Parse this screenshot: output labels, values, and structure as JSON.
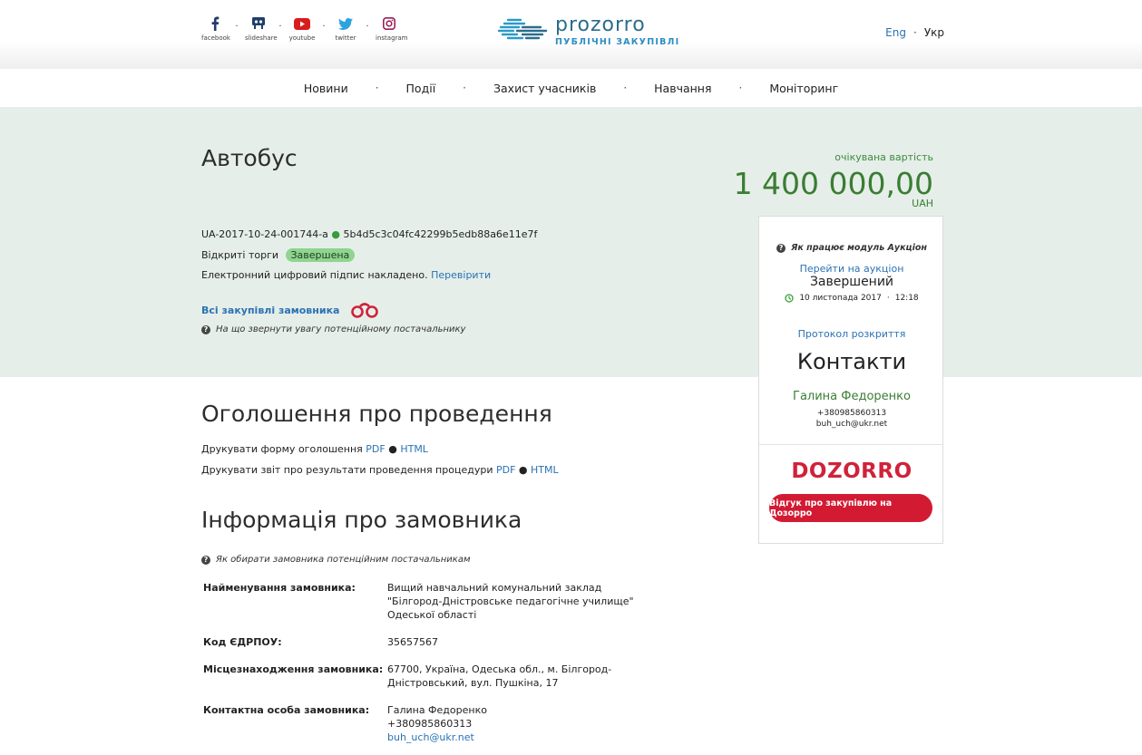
{
  "social": [
    {
      "label": "facebook",
      "icon": "facebook-icon"
    },
    {
      "label": "slideshare",
      "icon": "slideshare-icon"
    },
    {
      "label": "youtube",
      "icon": "youtube-icon"
    },
    {
      "label": "twitter",
      "icon": "twitter-icon"
    },
    {
      "label": "instagram",
      "icon": "instagram-icon"
    }
  ],
  "logo": {
    "name": "prozorro",
    "tagline": "ПУБЛІЧНІ ЗАКУПІВЛІ"
  },
  "lang": {
    "eng": "Eng",
    "ukr": "Укр"
  },
  "nav": [
    "Новини",
    "Події",
    "Захист учасників",
    "Навчання",
    "Моніторинг"
  ],
  "tender": {
    "title": "Автобус",
    "id": "UA-2017-10-24-001744-a",
    "hash": "5b4d5c3c04fc42299b5edb88a6e11e7f",
    "procedure": "Відкриті торги",
    "status": "Завершена",
    "signature": "Електронний цифровий підпис накладено.",
    "verify": "Перевірити",
    "all_purchases": "Всі закупівлі замовника",
    "attention_note": "На що звернути увагу потенційному постачальнику"
  },
  "value": {
    "label": "очікувана вартість",
    "amount": "1 400 000,00",
    "currency": "UAH"
  },
  "sidebox": {
    "auction_how": "Як працює модуль Аукціон",
    "go_auction": "Перейти на аукціон",
    "auction_status": "Завершений",
    "auction_date": "10 листопада 2017",
    "auction_time": "12:18",
    "protocol": "Протокол розкриття",
    "contacts_title": "Контакти",
    "contact_name": "Галина Федоренко",
    "contact_phone": "+380985860313",
    "contact_email": "buh_uch@ukr.net",
    "dozorro_logo": "DOZORRO",
    "dozorro_button": "Відгук про закупівлю на Дозорро"
  },
  "announcement": {
    "title": "Оголошення про проведення",
    "print_form": "Друкувати форму оголошення",
    "print_report": "Друкувати звіт про результати проведення процедури",
    "pdf": "PDF",
    "html": "HTML"
  },
  "customer": {
    "title": "Інформація про замовника",
    "note": "Як обирати замовника потенційним постачальникам",
    "name_label": "Найменування замовника:",
    "name_lines": [
      "Вищий навчальний комунальний заклад",
      "\"Білгород-Дністровське педагогічне училище\"",
      "Одеської області"
    ],
    "edrpou_label": "Код ЄДРПОУ:",
    "edrpou": "35657567",
    "location_label": "Місцезнаходження замовника:",
    "location_lines": [
      "67700, Україна, Одеська обл., м. Білгород-",
      "Дністровський, вул. Пушкіна, 17"
    ],
    "contact_label": "Контактна особа замовника:",
    "contact_name": "Галина Федоренко",
    "contact_phone": "+380985860313",
    "contact_email": "buh_uch@ukr.net"
  }
}
